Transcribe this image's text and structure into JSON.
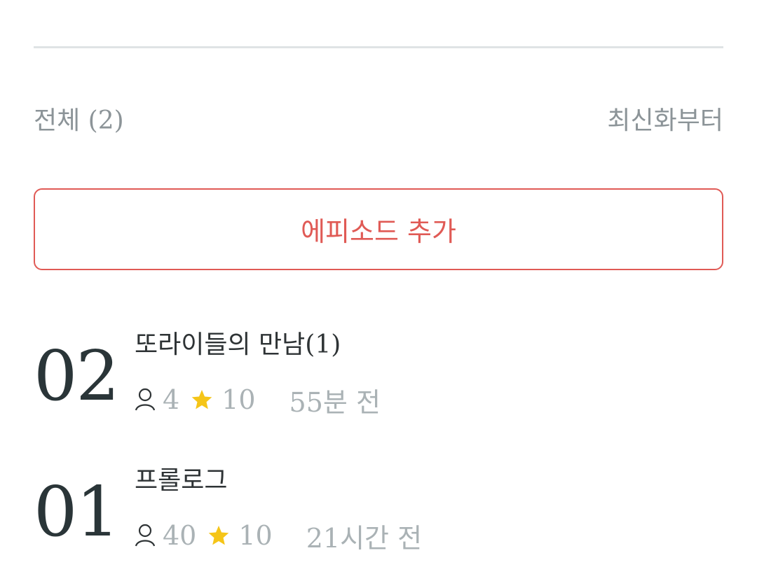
{
  "list_header": {
    "total_label": "전체 (2)",
    "sort_label": "최신화부터"
  },
  "add_episode": {
    "label": "에피소드 추가"
  },
  "colors": {
    "accent": "#e05a55",
    "star": "#f5c518",
    "muted_text": "#aab2b5"
  },
  "episodes": [
    {
      "number": "02",
      "title": "또라이들의 만남(1)",
      "views": "4",
      "rating": "10",
      "time": "55분 전"
    },
    {
      "number": "01",
      "title": "프롤로그",
      "views": "40",
      "rating": "10",
      "time": "21시간 전"
    }
  ]
}
